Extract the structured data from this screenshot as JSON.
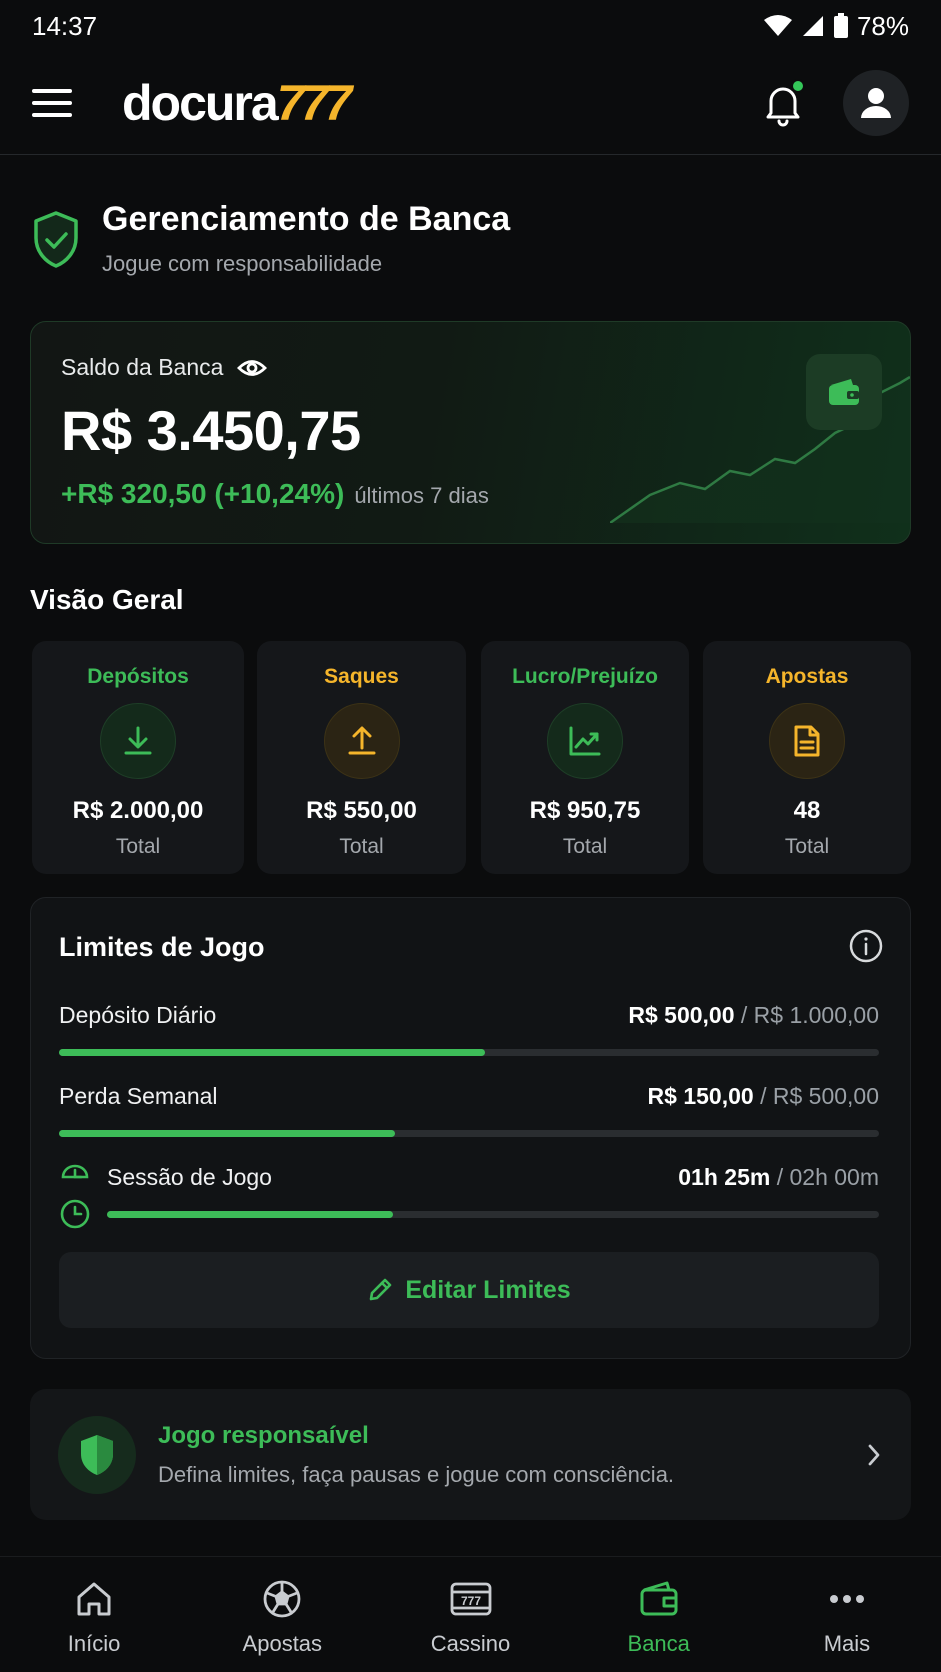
{
  "status_bar": {
    "time": "14:37",
    "battery": "78%"
  },
  "header": {
    "logo_text": "docura",
    "logo_number": "777"
  },
  "page": {
    "title": "Gerenciamento de Banca",
    "subtitle": "Jogue com responsabilidade"
  },
  "balance": {
    "label": "Saldo da Banca",
    "value": "R$ 3.450,75",
    "change": "+R$ 320,50 (+10,24%)",
    "period": "últimos 7 dias"
  },
  "overview": {
    "title": "Visão Geral",
    "stats": [
      {
        "label": "Depósitos",
        "value": "R$ 2.000,00",
        "sub": "Total",
        "icon": "download-icon",
        "color": "#3dbc58"
      },
      {
        "label": "Saques",
        "value": "R$ 550,00",
        "sub": "Total",
        "icon": "upload-icon",
        "color": "#f5b52b"
      },
      {
        "label": "Lucro/Prejuízo",
        "value": "R$ 950,75",
        "sub": "Total",
        "icon": "trend-chart-icon",
        "color": "#3dbc58"
      },
      {
        "label": "Apostas",
        "value": "48",
        "sub": "Total",
        "icon": "document-icon",
        "color": "#f5b52b"
      }
    ]
  },
  "limits": {
    "title": "Limites de Jogo",
    "rows": [
      {
        "name": "Depósito Diário",
        "current": "R$ 500,00",
        "max": "R$ 1.000,00",
        "progress": 0.52
      },
      {
        "name": "Perda Semanal",
        "current": "R$ 150,00",
        "max": "R$ 500,00",
        "progress": 0.41
      },
      {
        "name": "Sessão de Jogo",
        "current": "01h 25m",
        "max": "02h 00m",
        "progress": 0.37
      }
    ],
    "edit_label": "Editar Limites"
  },
  "responsible": {
    "title": "Jogo responsaível",
    "description": "Defina limites, faça pausas e jogue com consciência."
  },
  "nav": {
    "items": [
      {
        "label": "Início",
        "icon": "home-icon"
      },
      {
        "label": "Apostas",
        "icon": "soccer-ball-icon"
      },
      {
        "label": "Cassino",
        "icon": "slot-machine-icon"
      },
      {
        "label": "Banca",
        "icon": "wallet-icon",
        "active": true
      },
      {
        "label": "Mais",
        "icon": "more-icon"
      }
    ]
  }
}
